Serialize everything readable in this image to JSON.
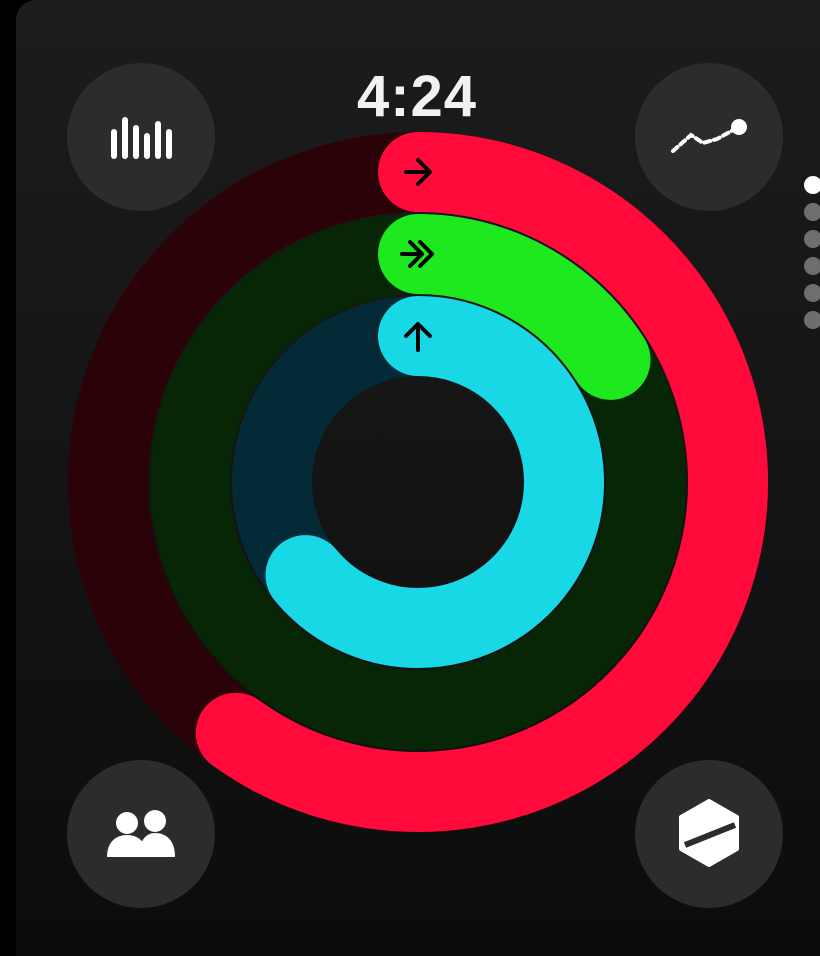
{
  "status": {
    "time": "4:24"
  },
  "buttons": {
    "history": {
      "icon": "bar-chart-icon"
    },
    "trends": {
      "icon": "trend-line-icon"
    },
    "sharing": {
      "icon": "people-icon"
    },
    "awards": {
      "icon": "award-badge-icon"
    }
  },
  "rings": {
    "move": {
      "progress": 0.6,
      "color": "#ff0a3a",
      "track": "#2a0208",
      "icon": "arrow-right-icon"
    },
    "exercise": {
      "progress": 0.16,
      "color": "#1ee81e",
      "track": "#062606",
      "icon": "double-arrow-right-icon"
    },
    "stand": {
      "progress": 0.64,
      "color": "#18d8e6",
      "track": "#032a36",
      "icon": "arrow-up-icon"
    }
  },
  "pagination": {
    "count": 6,
    "active": 0
  }
}
